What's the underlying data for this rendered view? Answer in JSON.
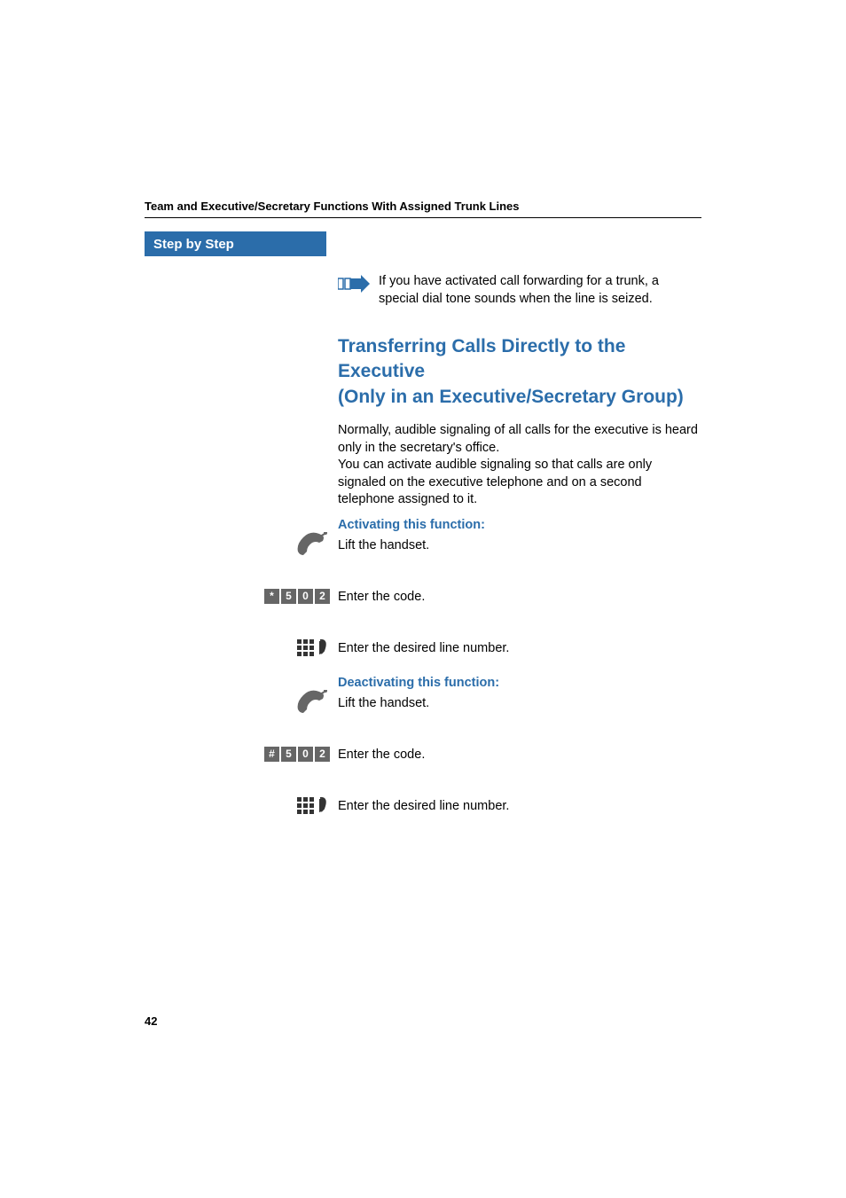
{
  "header": {
    "chapter_title": "Team and Executive/Secretary Functions With Assigned Trunk Lines"
  },
  "sidebar": {
    "title": "Step by Step"
  },
  "note": {
    "text": "If you have activated call forwarding for a trunk, a special dial tone sounds when the line is seized."
  },
  "section": {
    "title_line1": "Transferring Calls Directly to the Executive",
    "title_line2": "(Only in an Executive/Secretary Group)",
    "description": "Normally, audible signaling of all calls for the executive is heard only in the secretary's office.\nYou can activate audible signaling so that calls are only signaled on the executive telephone and on a second telephone assigned to it."
  },
  "activate": {
    "heading": "Activating this function:",
    "step1_text": "Lift the handset.",
    "step2_text": "Enter the code.",
    "step2_code": [
      "*",
      "5",
      "0",
      "2"
    ],
    "step3_text": "Enter the desired line number."
  },
  "deactivate": {
    "heading": "Deactivating this function:",
    "step1_text": "Lift the handset.",
    "step2_text": "Enter the code.",
    "step2_code": [
      "#",
      "5",
      "0",
      "2"
    ],
    "step3_text": "Enter the desired line number."
  },
  "footer": {
    "page_number": "42"
  }
}
